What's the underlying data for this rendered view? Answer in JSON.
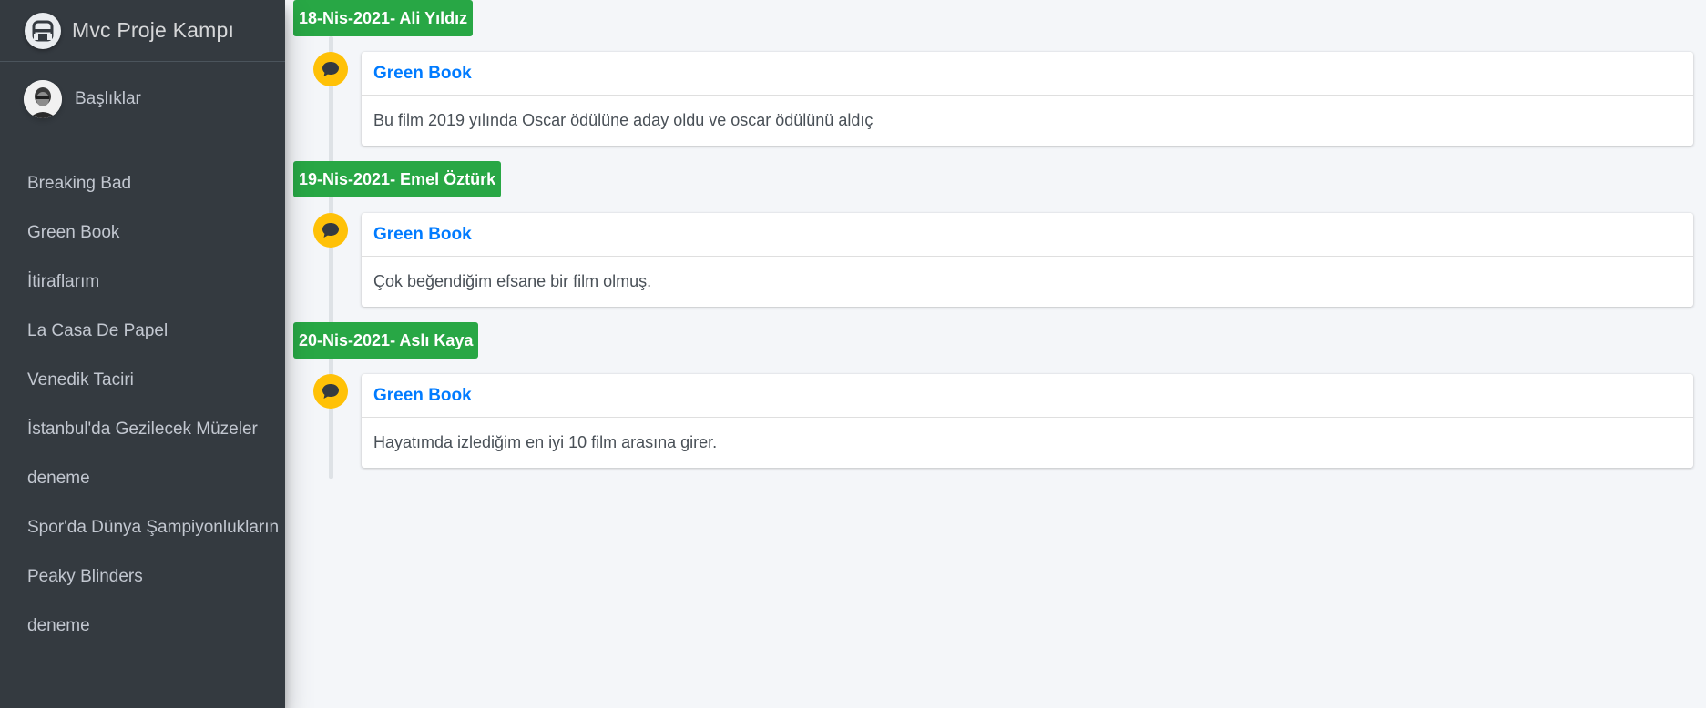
{
  "brand": {
    "title": "Mvc Proje Kampı"
  },
  "user": {
    "name": "Başlıklar"
  },
  "sidebar": {
    "items": [
      {
        "label": "Breaking Bad"
      },
      {
        "label": "Green Book"
      },
      {
        "label": "İtiraflarım"
      },
      {
        "label": "La Casa De Papel"
      },
      {
        "label": "Venedik Taciri"
      },
      {
        "label": "İstanbul'da Gezilecek Müzeler"
      },
      {
        "label": "deneme"
      },
      {
        "label": "Spor'da Dünya Şampiyonlukların"
      },
      {
        "label": "Peaky Blinders"
      },
      {
        "label": "deneme"
      }
    ]
  },
  "timeline": [
    {
      "label": "18-Nis-2021- Ali Yıldız",
      "title": "Green Book",
      "body": "Bu film 2019 yılında Oscar ödülüne aday oldu ve oscar ödülünü aldıç"
    },
    {
      "label": "19-Nis-2021- Emel Öztürk",
      "title": "Green Book",
      "body": "Çok beğendiğim efsane bir film olmuş."
    },
    {
      "label": "20-Nis-2021- Aslı Kaya",
      "title": "Green Book",
      "body": "Hayatımda izlediğim en iyi 10 film arasına girer."
    }
  ],
  "colors": {
    "sidebar_bg": "#343a40",
    "label_green": "#28a745",
    "icon_yellow": "#ffc107",
    "link_blue": "#007bff"
  },
  "icons": {
    "brand": "brand-logo-icon",
    "timeline": "comment-icon"
  }
}
